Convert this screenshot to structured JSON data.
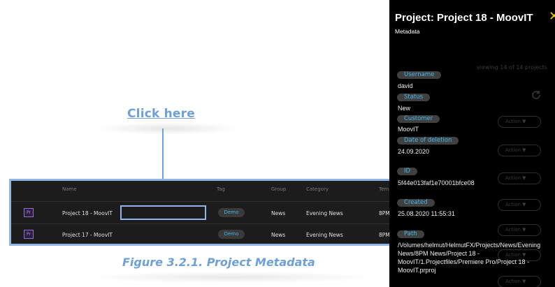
{
  "annotation": {
    "click_here": "Click here",
    "figure_caption": "Figure 3.2.1. Project Metadata"
  },
  "table": {
    "columns": [
      "Name",
      "Tag",
      "Group",
      "Category",
      "Temp"
    ],
    "rows": [
      {
        "icon": "Pr",
        "name": "Project 18 - MoovIT",
        "tag": "Demo",
        "group": "News",
        "category": "Evening News",
        "temp": "8PM"
      },
      {
        "icon": "Pr",
        "name": "Project 17 - MoovIT",
        "tag": "Demo",
        "group": "News",
        "category": "Evening News",
        "temp": "8PM"
      }
    ]
  },
  "panel": {
    "title": "Project: Project 18 - MoovIT",
    "subtitle": "Metadata",
    "close_icon": "close-icon",
    "background": {
      "viewing_text": "viewing 14 of 14 projects",
      "action_label": "Action ▼"
    },
    "fields": {
      "username": {
        "label": "Username",
        "value": "david"
      },
      "status": {
        "label": "Status",
        "value": "New"
      },
      "customer": {
        "label": "Customer",
        "value": "MoovIT"
      },
      "deletion": {
        "label": "Date of deletion",
        "value": "24.09.2020"
      },
      "id": {
        "label": "ID",
        "value": "5f44e013faf1e70001bfce08"
      },
      "created": {
        "label": "Created",
        "value": "25.08.2020 11:55:31"
      },
      "path": {
        "label": "Path",
        "value": "/Volumes/helmut/HelmutFX/Projects/News/Evening News/8PM News/Project 18 - MoovIT/1.Projectfiles/Premiere Pro/Project 18 - MoovIT.prproj"
      }
    }
  },
  "colors": {
    "accent": "#6ea0d8",
    "tag_text": "#3fb4e8",
    "close": "#f0d000",
    "premiere": "#9b6bd6"
  }
}
